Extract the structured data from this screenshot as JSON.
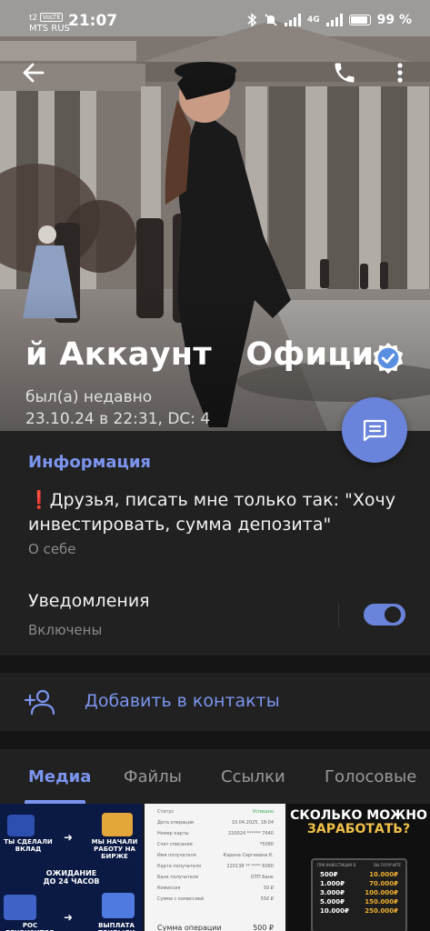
{
  "status_bar": {
    "signal_text": "t2",
    "volte": "VoLTE",
    "carrier": "MTS RUS",
    "time": "21:07",
    "network": "4G",
    "battery": "99 %",
    "battery_level": 0.99
  },
  "top_bar": {
    "back_icon": "arrow-left-icon",
    "call_icon": "phone-icon",
    "menu_icon": "more-vertical-icon"
  },
  "profile": {
    "name": "й Аккаунт   Офици",
    "verified_icon": "verified-badge-icon",
    "last_seen_line1": "был(а) недавно",
    "last_seen_line2": "23.10.24 в 22:31, DC: 4",
    "message_button_icon": "message-icon"
  },
  "info": {
    "title": "Информация",
    "bio_mark": "❗",
    "bio": "Друзья, писать мне только так: \"Хочу инвестировать, сумма депозита\"",
    "bio_label": "О себе",
    "notifications_label": "Уведомления",
    "notifications_state": "Включены",
    "notifications_on": true
  },
  "actions": {
    "add_contact_icon": "add-person-icon",
    "add_contact_label": "Добавить в контакты"
  },
  "tabs": [
    {
      "label": "Медиа",
      "active": true
    },
    {
      "label": "Файлы",
      "active": false
    },
    {
      "label": "Ссылки",
      "active": false
    },
    {
      "label": "Голосовые",
      "active": false
    }
  ],
  "media": {
    "item1": {
      "tl": "ТЫ СДЕЛАЛИ ВКЛАД",
      "tr": "МЫ НАЧАЛИ РАБОТУ НА БИРЖЕ",
      "mid_1": "ОЖИДАНИЕ",
      "mid_2": "ДО 24 ЧАСОВ",
      "bl": "РОС РЕКВИЗИТОВ ДЛЯ ВЫПЛАТЫ",
      "br": "ВЫПЛАТА ПРИБЫЛИ"
    },
    "item2": {
      "rows": [
        {
          "k": "Статус",
          "v": "Успешно"
        },
        {
          "k": "Дата операции",
          "v": "10.04.2025, 18:04"
        },
        {
          "k": "Номер карты",
          "v": "220024 ****** 7640"
        },
        {
          "k": "Счет списания",
          "v": "*5080"
        },
        {
          "k": "Имя получателя",
          "v": "Карина Сергеевна К."
        },
        {
          "k": "Карта получателя",
          "v": "220138 ** **** 6060"
        },
        {
          "k": "Банк получателя",
          "v": "ОТП Банк"
        },
        {
          "k": "Комиссия",
          "v": "50 ₽"
        },
        {
          "k": "Сумма с комиссией",
          "v": "550 ₽"
        }
      ],
      "total_label": "Сумма операции",
      "total_value": "500 ₽"
    },
    "item3": {
      "headline_1": "СКОЛЬКО МОЖНО",
      "headline_2": "ЗАРАБОТАТЬ?",
      "col_left": "ПРИ ИНВЕСТИЦИИ В",
      "col_right": "ВЫ ПОЛУЧИТЕ",
      "rows": [
        {
          "from": "500₽",
          "to": "10.000₽"
        },
        {
          "from": "1.000₽",
          "to": "70.000₽"
        },
        {
          "from": "3.000₽",
          "to": "100.000₽"
        },
        {
          "from": "5.000₽",
          "to": "150.000₽"
        },
        {
          "from": "10.000₽",
          "to": "250.000₽"
        }
      ]
    }
  },
  "colors": {
    "accent": "#6a84dc",
    "link": "#7b95ee",
    "background": "#212121",
    "divider": "#151515"
  }
}
